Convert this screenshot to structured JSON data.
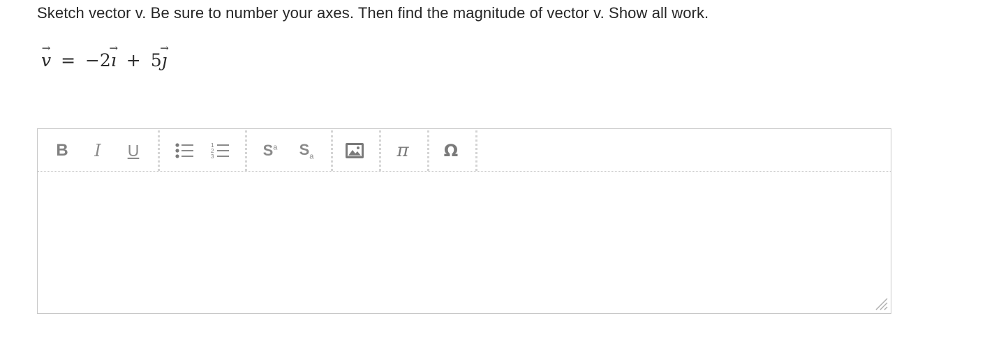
{
  "question": {
    "text": "Sketch vector v. Be sure to number your axes. Then find the magnitude of vector v. Show all work."
  },
  "equation": {
    "lhs": "v",
    "equals": "=",
    "term1_coef": "−2",
    "term1_unit": "ı",
    "plus": "+",
    "term2_coef": "5",
    "term2_unit": "ȷ"
  },
  "editor": {
    "toolbar": {
      "bold_label": "B",
      "italic_label": "I",
      "underline_label": "U",
      "superscript_base": "S",
      "superscript_mark": "a",
      "subscript_base": "S",
      "subscript_mark": "a",
      "pi_label": "π",
      "omega_label": "Ω"
    },
    "content": ""
  }
}
